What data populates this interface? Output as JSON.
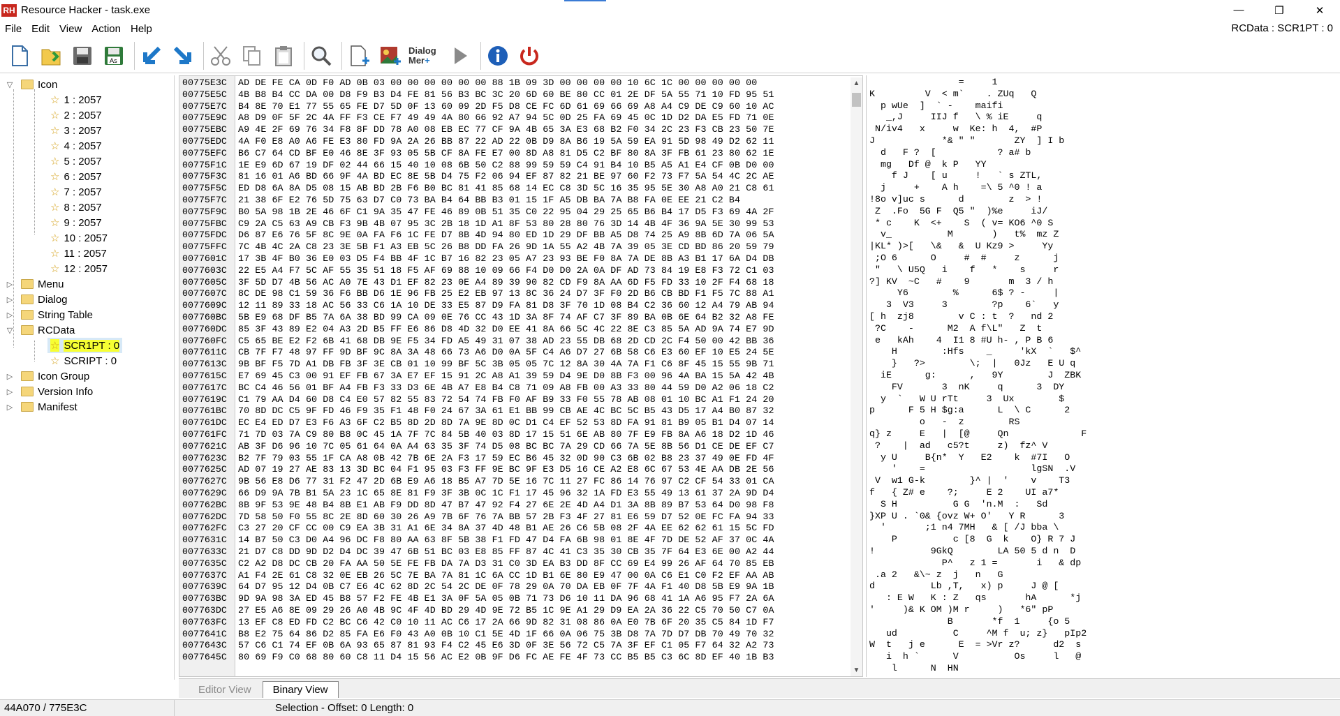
{
  "window": {
    "app_icon_text": "RH",
    "title": "Resource Hacker - task.exe",
    "minimize": "—",
    "maximize": "❐",
    "close": "✕"
  },
  "menu": [
    "File",
    "Edit",
    "View",
    "Action",
    "Help"
  ],
  "rcdata_indicator": "RCData : SCR1PT : 0",
  "toolbar": {
    "dialog_merger_label_1": "Dialog",
    "dialog_merger_label_2": "Mer"
  },
  "tree": {
    "icon_group": {
      "label": "Icon",
      "expanded": true,
      "items": [
        "1 : 2057",
        "2 : 2057",
        "3 : 2057",
        "4 : 2057",
        "5 : 2057",
        "6 : 2057",
        "7 : 2057",
        "8 : 2057",
        "9 : 2057",
        "10 : 2057",
        "11 : 2057",
        "12 : 2057"
      ]
    },
    "menu": "Menu",
    "dialog": "Dialog",
    "string_table": "String Table",
    "rcdata": {
      "label": "RCData",
      "expanded": true,
      "items": [
        "SCR1PT : 0",
        "SCRIPT : 0"
      ],
      "selected": "SCR1PT : 0"
    },
    "icon_group_folder": "Icon Group",
    "version_info": "Version Info",
    "manifest": "Manifest"
  },
  "hex": {
    "rows": [
      [
        "00775E3C",
        "AD DE FE CA 0D F0 AD 0B 03 00 00 00 00 00 00 88 1B 09 3D 00 00 00 00 10 6C 1C 00 00 00 00 00"
      ],
      [
        "00775E5C",
        "4B B8 B4 CC DA 00 D8 F9 B3 D4 FE 81 56 B3 BC 3C 20 6D 60 BE 80 CC 01 2E DF 5A 55 71 10 FD 95 51"
      ],
      [
        "00775E7C",
        "B4 8E 70 E1 77 55 65 FE D7 5D 0F 13 60 09 2D F5 D8 CE FC 6D 61 69 66 69 A8 A4 C9 DE C9 60 10 AC"
      ],
      [
        "00775E9C",
        "A8 D9 0F 5F 2C 4A FF F3 CE F7 49 49 4A 80 66 92 A7 94 5C 0D 25 FA 69 45 0C 1D D2 DA E5 FD 71 0E"
      ],
      [
        "00775EBC",
        "A9 4E 2F 69 76 34 F8 8F DD 78 A0 08 EB EC 77 CF 9A 4B 65 3A E3 68 B2 F0 34 2C 23 F3 CB 23 50 7E"
      ],
      [
        "00775EDC",
        "4A F0 E8 A0 A6 FE E3 80 FD 9A 2A 26 BB 87 22 AD 22 0B D9 8A B6 19 5A 59 EA 91 5D 98 49 D2 62 11"
      ],
      [
        "00775EFC",
        "B6 C7 64 CD BF E0 46 8E 3F 93 05 5B CF 8A FE E7 00 8D A8 81 D5 C2 BF 80 8A 3F FB 61 23 80 62 1E"
      ],
      [
        "00775F1C",
        "1E E9 6D 67 19 DF 02 44 66 15 40 10 08 6B 50 C2 88 99 59 59 C4 91 B4 10 B5 A5 A1 E4 CF 0B D0 00"
      ],
      [
        "00775F3C",
        "81 16 01 A6 BD 66 9F 4A BD EC 8E 5B D4 75 F2 06 94 EF 87 82 21 BE 97 60 F2 73 F7 5A 54 4C 2C AE"
      ],
      [
        "00775F5C",
        "ED D8 6A 8A D5 08 15 AB BD 2B F6 B0 BC 81 41 85 68 14 EC C8 3D 5C 16 35 95 5E 30 A8 A0 21 C8 61"
      ],
      [
        "00775F7C",
        "21 38 6F E2 76 5D 75 63 D7 C0 73 BA B4 64 BB B3 01 15 1F A5 DB BA 7A B8 FA 0E EE 21 C2 B4"
      ],
      [
        "00775F9C",
        "B0 5A 98 1B 2E 46 6F C1 9A 35 47 FE 46 89 0B 51 35 C0 22 95 04 29 25 65 B6 B4 17 D5 F3 69 4A 2F"
      ],
      [
        "00775FBC",
        "C9 2A C5 63 A9 CB F3 9B 4B 07 95 3C 2B 18 1D A1 8F 53 80 28 80 76 3D 14 4B 4F 36 9A 5E 30 99 53"
      ],
      [
        "00775FDC",
        "D6 87 E6 76 5F 8C 9E 0A FA F6 1C FE D7 8B 4D 94 80 ED 1D 29 DF BB A5 D8 74 25 A9 8B 6D 7A 06 5A"
      ],
      [
        "00775FFC",
        "7C 4B 4C 2A C8 23 3E 5B F1 A3 EB 5C 26 B8 DD FA 26 9D 1A 55 A2 4B 7A 39 05 3E CD BD 86 20 59 79"
      ],
      [
        "0077601C",
        "17 3B 4F B0 36 E0 03 D5 F4 BB 4F 1C B7 16 82 23 05 A7 23 93 BE F0 8A 7A DE 8B A3 B1 17 6A D4 DB"
      ],
      [
        "0077603C",
        "22 E5 A4 F7 5C AF 55 35 51 18 F5 AF 69 88 10 09 66 F4 D0 D0 2A 0A DF AD 73 84 19 E8 F3 72 C1 03"
      ],
      [
        "0077605C",
        "3F 5D D7 4B 56 AC A0 7E 43 D1 EF 82 23 0E A4 89 39 90 82 CD F9 8A AA 6D F5 FD 33 10 2F F4 68 18"
      ],
      [
        "0077607C",
        "8C DE 98 C1 59 36 F6 BB D6 1E 96 FB 25 E2 EB 97 13 8C 36 24 D7 3F F0 2D B6 CB BD F1 F5 7C 88 A1"
      ],
      [
        "0077609C",
        "12 11 89 33 18 AC 56 33 C6 1A 10 DE 33 E5 87 D9 FA 81 D8 3F 70 1D 08 B4 C2 36 60 12 A4 79 AB 94"
      ],
      [
        "007760BC",
        "5B E9 68 DF B5 7A 6A 38 BD 99 CA 09 0E 76 CC 43 1D 3A 8F 74 AF C7 3F 89 BA 0B 6E 64 B2 32 A8 FE"
      ],
      [
        "007760DC",
        "85 3F 43 89 E2 04 A3 2D B5 FF E6 86 D8 4D 32 D0 EE 41 8A 66 5C 4C 22 8E C3 85 5A AD 9A 74 E7 9D"
      ],
      [
        "007760FC",
        "C5 65 BE E2 F2 6B 41 68 DB 9E F5 34 FD A5 49 31 07 38 AD 23 55 DB 68 2D CD 2C F4 50 00 42 BB 36"
      ],
      [
        "0077611C",
        "CB 7F F7 48 97 FF 9D BF 9C 8A 3A 48 66 73 A6 D0 0A 5F C4 A6 D7 27 6B 58 C6 E3 60 EF 10 E5 24 5E"
      ],
      [
        "0077613C",
        "9B BF F5 7D A1 DB FB 3F 3E CB 01 10 99 BF 5C 3B 05 05 7C 12 8A 30 4A 7A F1 C6 8F 45 15 55 9B 71"
      ],
      [
        "0077615C",
        "E7 69 45 C3 00 91 EF FB 67 3A E7 EF 15 91 2C A8 A1 39 59 D4 9E D0 8B F3 00 96 4A BA 15 5A 42 4B"
      ],
      [
        "0077617C",
        "BC C4 46 56 01 BF A4 FB F3 33 D3 6E 4B A7 E8 B4 C8 71 09 A8 FB 00 A3 33 80 44 59 D0 A2 06 18 C2"
      ],
      [
        "0077619C",
        "C1 79 AA D4 60 D8 C4 E0 57 82 55 83 72 54 74 FB F0 AF B9 33 F0 55 78 AB 08 01 10 BC A1 F1 24 20"
      ],
      [
        "007761BC",
        "70 8D DC C5 9F FD 46 F9 35 F1 48 F0 24 67 3A 61 E1 BB 99 CB AE 4C BC 5C B5 43 D5 17 A4 B0 87 32"
      ],
      [
        "007761DC",
        "EC E4 ED D7 E3 F6 A3 6F C2 B5 8D 2D 8D 7A 9E 8D 0C D1 C4 EF 52 53 8D FA 91 81 B9 05 B1 D4 07 14"
      ],
      [
        "007761FC",
        "71 7D 03 7A C9 80 B8 0C 45 1A 7F 7C 84 5B 40 03 8D 17 15 51 6E AB 80 7F E9 FB 8A A6 18 D2 1D 46"
      ],
      [
        "0077621C",
        "AB 3F D6 96 10 7C 05 61 64 0A A4 63 35 3F 74 D5 08 BC BC 7A 29 CD 66 7A 5E 8B 56 D1 CE DE EF C7"
      ],
      [
        "0077623C",
        "B2 7F 79 03 55 1F CA A8 0B 42 7B 6E 2A F3 17 59 EC B6 45 32 0D 90 C3 6B 02 B8 23 37 49 0E FD 4F"
      ],
      [
        "0077625C",
        "AD 07 19 27 AE 83 13 3D BC 04 F1 95 03 F3 FF 9E BC 9F E3 D5 16 CE A2 E8 6C 67 53 4E AA DB 2E 56"
      ],
      [
        "0077627C",
        "9B 56 E8 D6 77 31 F2 47 2D 6B E9 A6 18 B5 A7 7D 5E 16 7C 11 27 FC 86 14 76 97 C2 CF 54 33 01 CA"
      ],
      [
        "0077629C",
        "66 D9 9A 7B B1 5A 23 1C 65 8E 81 F9 3F 3B 0C 1C F1 17 45 96 32 1A FD E3 55 49 13 61 37 2A 9D D4"
      ],
      [
        "007762BC",
        "8B 9F 53 9E 48 B4 8B E1 AB F9 DD 8D 47 B7 47 92 F4 27 6E 2E 4D A4 D1 3A 8B 89 B7 53 64 D0 98 F8"
      ],
      [
        "007762DC",
        "7D 58 50 F0 55 8C 2E 8D 60 30 26 A9 7B 6F 76 7A BB 57 2B F3 4F 27 81 E6 59 D7 52 0E FC FA 94 33"
      ],
      [
        "007762FC",
        "C3 27 20 CF CC 00 C9 EA 3B 31 A1 6E 34 8A 37 4D 48 B1 AE 26 C6 5B 08 2F 4A EE 62 62 61 15 5C FD"
      ],
      [
        "0077631C",
        "14 B7 50 C3 D0 A4 96 DC F8 80 AA 63 8F 5B 38 F1 FD 47 D4 FA 6B 98 01 8E 4F 7D DE 52 AF 37 0C 4A"
      ],
      [
        "0077633C",
        "21 D7 C8 DD 9D D2 D4 DC 39 47 6B 51 BC 03 E8 85 FF 87 4C 41 C3 35 30 CB 35 7F 64 E3 6E 00 A2 44"
      ],
      [
        "0077635C",
        "C2 A2 D8 DC CB 20 FA AA 50 5E FE FB DA 7A D3 31 C0 3D EA B3 DD 8F CC 69 E4 99 26 AF 64 70 85 EB"
      ],
      [
        "0077637C",
        "A1 F4 2E 61 C8 32 0E EB 26 5C 7E BA 7A 81 1C 6A CC 1D B1 6E 80 E9 47 00 0A C6 E1 C0 F2 EF AA AB"
      ],
      [
        "0077639C",
        "64 D7 95 12 D4 0B C7 E6 4C 62 8D 2C 54 2C DE 0F 78 29 0A 70 DA EB 0F 7F 4A F1 40 D8 5B E9 9A 1B"
      ],
      [
        "007763BC",
        "9D 9A 98 3A ED 45 B8 57 F2 FE 4B E1 3A 0F 5A 05 0B 71 73 D6 10 11 DA 96 68 41 1A A6 95 F7 2A 6A"
      ],
      [
        "007763DC",
        "27 E5 A6 8E 09 29 26 A0 4B 9C 4F 4D BD 29 4D 9E 72 B5 1C 9E A1 29 D9 EA 2A 36 22 C5 70 50 C7 0A"
      ],
      [
        "007763FC",
        "13 EF C8 ED FD C2 BC C6 42 C0 10 11 AC C6 17 2A 66 9D 82 31 08 86 0A E0 7B 6F 20 35 C5 84 1D F7"
      ],
      [
        "0077641C",
        "B8 E2 75 64 86 D2 85 FA E6 F0 43 A0 0B 10 C1 5E 4D 1F 66 0A 06 75 3B D8 7A 7D D7 DB 70 49 70 32"
      ],
      [
        "0077643C",
        "57 C6 C1 74 EF 0B 6A 93 65 87 81 93 F4 C2 45 E6 3D 0F 3E 56 72 C5 7A 3F EF C1 05 F7 64 32 A2 73"
      ],
      [
        "0077645C",
        "80 69 F9 C0 68 80 60 C8 11 D4 15 56 AC E2 0B 9F D6 FC AE FE 4F 73 CC B5 B5 C3 6C 8D EF 40 1B B3"
      ]
    ],
    "ascii": [
      "                =     1",
      "K         V  < m`    . ZUq   Q",
      "  p wUe  ]  ` -    maifi",
      "   _,J     IIJ f   \\ % iE     q",
      " N/iv4   x     w  Ke: h  4,  #P",
      "J            *& \" \"       ZY  ] I b",
      "  d   F ?  [           ? a# b",
      "  mg   Df @  k P   YY",
      "    f J    [ u     !   ` s ZTL,",
      "  j     +    A h    =\\ 5 ^0 ! a",
      "!8o v]uc s      d        z  > !",
      " Z  .Fo  5G F  Q5 \"  )%e     iJ/",
      " * c    K  <+    S  ( v= KO6 ^0 S",
      "  v_          M       )   t%  mz Z",
      "|KL* )>[   \\&   &  U Kz9 >     Yy",
      " ;O 6      O     #  #     z      j",
      " \"   \\ U5Q   i    f   *    s     r",
      "?] KV  ~C   #    9       m  3 / h",
      "     Y6        %      6$ ? -     |",
      "   3  V3     3        ?p    6`   y",
      "[ h  zj8        v C : t  ?   nd 2",
      " ?C    -      M2  A f\\L\"   Z  t",
      " e   kAh    4  I1 8 #U h- , P B 6",
      "    H        :Hfs    _     'kX  `   $^",
      "    }   ?>        \\;  |   0Jz   E U q",
      "  iE      g:      ,   9Y        J  ZBK",
      "    FV       3  nK     q      3  DY",
      "  y  `   W U rTt     3  Ux        $",
      "p      F 5 H $g:a      L  \\ C      2",
      "         o   -  z        RS",
      "q} z     E   |  [@     Qn             F",
      " ?    |  ad   c5?t     z)  fz^ V",
      "  y U     B{n*  Y   E2    k  #7I   O",
      "    '    =                   lgSN  .V",
      " V  w1 G-k        }^ |  '    v    T3",
      "f   { Z# e    ?;     E 2    UI a7*",
      "  S H          G G  'n.M  :   Sd",
      "}XP U . `0& {ovz W+ O'   Y R      3",
      "  '       ;1 n4 7MH   & [ /J bba \\",
      "    P          c [8  G  k    O} R 7 J",
      "!          9GkQ        LA 50 5 d n  D",
      "             P^   z 1 =       i   & dp",
      " .a 2   &\\~ z  j   n   G",
      "d          Lb ,T,   x) p     J @ [",
      "   : E W   K : Z   qs       hA      *j",
      "'     )& K OM )M r     )   *6\" pP",
      "              B       *f  1     {o 5",
      "   ud          C     ^M f  u; z}   pIp2",
      "W  t   j e      E  = >Vr z?      d2  s",
      "   i  h `      V          Os     l   @",
      "    l      N  HN"
    ]
  },
  "tabs": {
    "editor": "Editor View",
    "binary": "Binary View"
  },
  "status": {
    "left": "44A070 / 775E3C",
    "selection": "Selection - Offset: 0 Length: 0"
  }
}
